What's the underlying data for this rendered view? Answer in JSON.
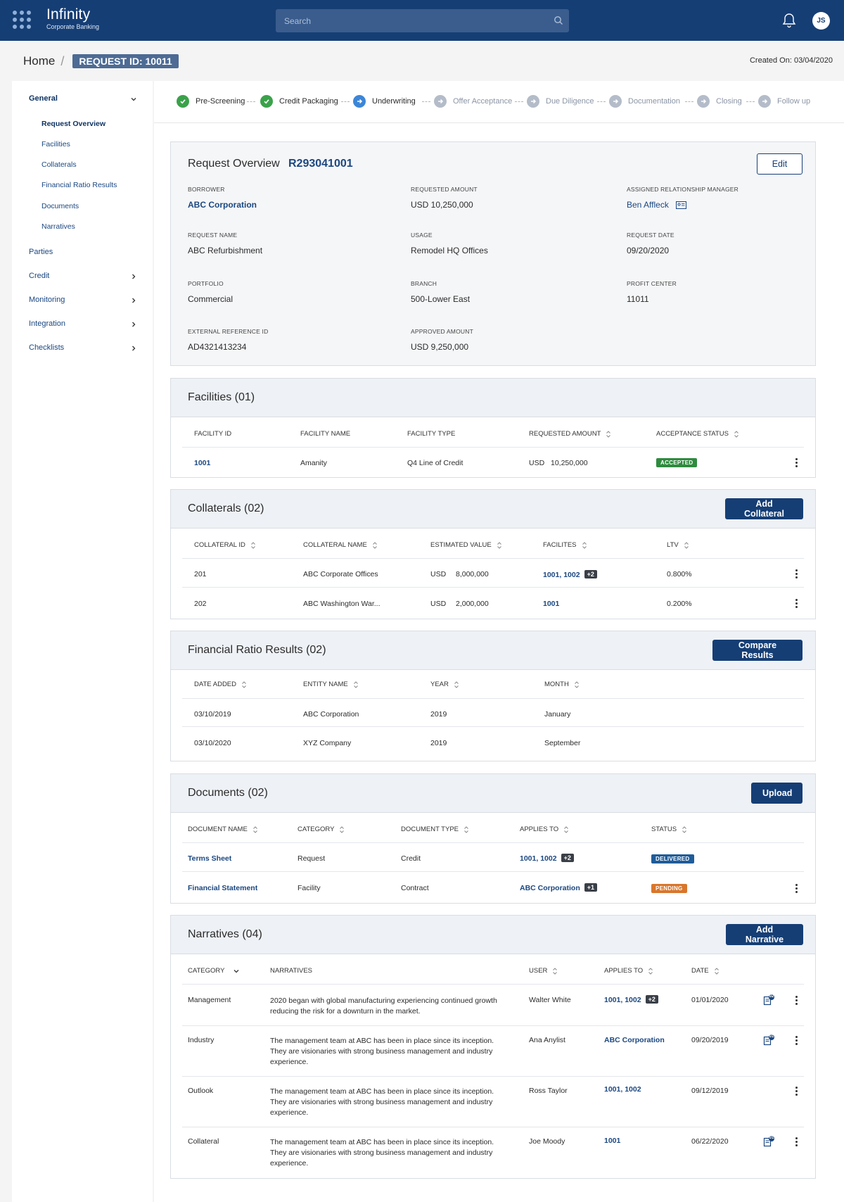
{
  "header": {
    "brand_name": "Infinity",
    "brand_sub": "Corporate Banking",
    "search_placeholder": "Search",
    "avatar_initials": "JS"
  },
  "breadcrumb": {
    "home": "Home",
    "request_id": "REQUEST ID: 10011",
    "created_on": "Created On: 03/04/2020"
  },
  "sidebar": {
    "general": "General",
    "sub_items": [
      "Request Overview",
      "Facilities",
      "Collaterals",
      "Financial Ratio Results",
      "Documents",
      "Narratives"
    ],
    "items": [
      "Parties",
      "Credit",
      "Monitoring",
      "Integration",
      "Checklists"
    ]
  },
  "stepper": {
    "steps": [
      {
        "label": "Pre-Screening",
        "state": "done"
      },
      {
        "label": "Credit Packaging",
        "state": "done"
      },
      {
        "label": "Underwriting",
        "state": "current"
      },
      {
        "label": "Offer Acceptance",
        "state": "todo"
      },
      {
        "label": "Due Diligence",
        "state": "todo"
      },
      {
        "label": "Documentation",
        "state": "todo"
      },
      {
        "label": "Closing",
        "state": "todo"
      },
      {
        "label": "Follow up",
        "state": "todo"
      }
    ]
  },
  "overview": {
    "title": "Request Overview",
    "id": "R293041001",
    "edit_label": "Edit",
    "fields": {
      "borrower_label": "BORROWER",
      "borrower": "ABC Corporation",
      "requested_amount_label": "REQUESTED AMOUNT",
      "requested_amount": "USD 10,250,000",
      "manager_label": "ASSIGNED RELATIONSHIP MANAGER",
      "manager": "Ben Affleck",
      "request_name_label": "REQUEST NAME",
      "request_name": "ABC Refurbishment",
      "usage_label": "USAGE",
      "usage": "Remodel HQ Offices",
      "request_date_label": "REQUEST DATE",
      "request_date": "09/20/2020",
      "portfolio_label": "PORTFOLIO",
      "portfolio": "Commercial",
      "branch_label": "BRANCH",
      "branch": "500-Lower East",
      "profit_center_label": "PROFIT CENTER",
      "profit_center": "11011",
      "ext_ref_label": "EXTERNAL REFERENCE ID",
      "ext_ref": "AD4321413234",
      "approved_amount_label": "APPROVED AMOUNT",
      "approved_amount": "USD 9,250,000"
    }
  },
  "facilities": {
    "title": "Facilities (01)",
    "headers": [
      "FACILITY ID",
      "FACILITY NAME",
      "FACILITY TYPE",
      "REQUESTED AMOUNT",
      "ACCEPTANCE STATUS"
    ],
    "rows": [
      {
        "id": "1001",
        "name": "Amanity",
        "type": "Q4 Line of Credit",
        "currency": "USD",
        "amount": "10,250,000",
        "status": "ACCEPTED"
      }
    ]
  },
  "collaterals": {
    "title": "Collaterals (02)",
    "button": "Add Collateral",
    "headers": [
      "COLLATERAL ID",
      "COLLATERAL NAME",
      "ESTIMATED VALUE",
      "FACILITES",
      "LTV"
    ],
    "rows": [
      {
        "id": "201",
        "name": "ABC Corporate Offices",
        "currency": "USD",
        "value": "8,000,000",
        "facilities": "1001, 1002",
        "extra": "+2",
        "ltv": "0.800%"
      },
      {
        "id": "202",
        "name": "ABC Washington War...",
        "currency": "USD",
        "value": "2,000,000",
        "facilities": "1001",
        "extra": "",
        "ltv": "0.200%"
      }
    ]
  },
  "ratios": {
    "title": "Financial Ratio Results (02)",
    "button": "Compare Results",
    "headers": [
      "DATE ADDED",
      "ENTITY NAME",
      "YEAR",
      "MONTH"
    ],
    "rows": [
      {
        "date": "03/10/2019",
        "entity": "ABC Corporation",
        "year": "2019",
        "month": "January"
      },
      {
        "date": "03/10/2020",
        "entity": "XYZ Company",
        "year": "2019",
        "month": "September"
      }
    ]
  },
  "documents": {
    "title": "Documents (02)",
    "button": "Upload",
    "headers": [
      "DOCUMENT NAME",
      "CATEGORY",
      "DOCUMENT TYPE",
      "APPLIES TO",
      "STATUS"
    ],
    "rows": [
      {
        "name": "Terms Sheet",
        "category": "Request",
        "type": "Credit",
        "applies": "1001, 1002",
        "extra": "+2",
        "status": "DELIVERED"
      },
      {
        "name": "Financial Statement",
        "category": "Facility",
        "type": "Contract",
        "applies": "ABC Corporation",
        "extra": "+1",
        "status": "PENDING"
      }
    ]
  },
  "narratives": {
    "title": "Narratives (04)",
    "button": "Add Narrative",
    "headers": [
      "CATEGORY",
      "NARRATIVES",
      "USER",
      "APPLIES TO",
      "DATE"
    ],
    "rows": [
      {
        "category": "Management",
        "text": "2020 began with global manufacturing experiencing continued growth reducing the risk for a downturn in the market.",
        "user": "Walter White",
        "applies": "1001, 1002",
        "extra": "+2",
        "date": "01/01/2020",
        "notes": "02"
      },
      {
        "category": "Industry",
        "text": "The management team at ABC has been in place since its inception. They are visionaries with strong business management and industry experience.",
        "user": "Ana Anylist",
        "applies": "ABC Corporation",
        "extra": "",
        "date": "09/20/2019",
        "notes": "01"
      },
      {
        "category": "Outlook",
        "text": "The management team at ABC has been in place since its inception. They are visionaries with strong business management and industry experience.",
        "user": "Ross Taylor",
        "applies": "1001, 1002",
        "extra": "",
        "date": "09/12/2019",
        "notes": ""
      },
      {
        "category": "Collateral",
        "text": "The management team at ABC has been in place since its inception. They are visionaries with strong business management and industry experience.",
        "user": "Joe Moody",
        "applies": "1001",
        "extra": "",
        "date": "06/22/2020",
        "notes": "01"
      }
    ]
  },
  "colors": {
    "header_bg": "#153e75",
    "link": "#1b4780",
    "accepted": "#2e8b3e",
    "delivered": "#1f5c99",
    "pending": "#d9762b"
  }
}
